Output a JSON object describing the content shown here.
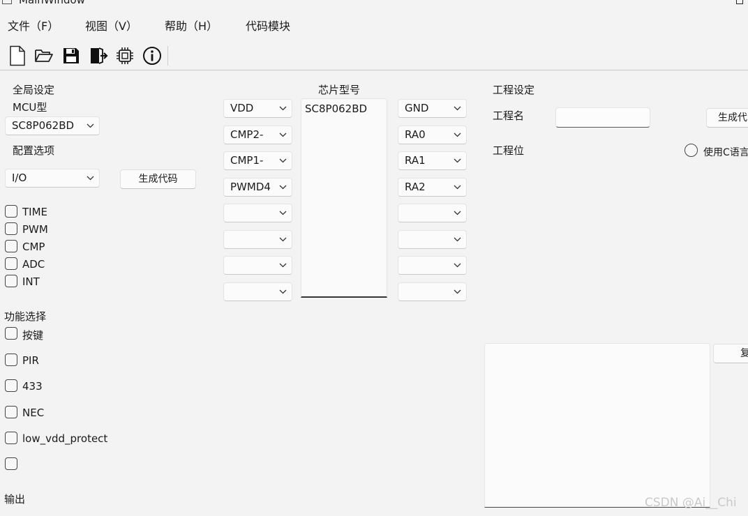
{
  "window": {
    "title": "MainWindow"
  },
  "menu": [
    "文件（F）",
    "视图（V）",
    "帮助（H）",
    "代码模块"
  ],
  "toolbar": {
    "icons": [
      "new-file-icon",
      "open-folder-icon",
      "save-icon",
      "exit-icon",
      "chip-icon",
      "info-icon"
    ]
  },
  "global": {
    "title": "全局设定",
    "mcu_label": "MCU型",
    "mcu_value": "SC8P062BD",
    "config_label": "配置选项",
    "config_value": "I/O",
    "generate_button": "生成代码",
    "options": [
      "TIME",
      "PWM",
      "CMP",
      "ADC",
      "INT"
    ]
  },
  "functions": {
    "title": "功能选择",
    "items": [
      "按键",
      "PIR",
      "433",
      "NEC",
      "low_vdd_protect",
      ""
    ]
  },
  "output_label": "输出",
  "chip": {
    "title": "芯片型号",
    "list": [
      "SC8P062BD"
    ],
    "left_pins": [
      "VDD",
      "CMP2-",
      "CMP1-",
      "PWMD4",
      "",
      "",
      "",
      ""
    ],
    "right_pins": [
      "GND",
      "RA0",
      "RA1",
      "RA2",
      "",
      "",
      "",
      ""
    ]
  },
  "project": {
    "title": "工程设定",
    "name_label": "工程名",
    "name_value": "",
    "location_label": "工程位",
    "generate_button": "生成代",
    "use_c_label": "使用C语言",
    "copy_button": "复"
  },
  "watermark": "CSDN @Ai__Chi"
}
